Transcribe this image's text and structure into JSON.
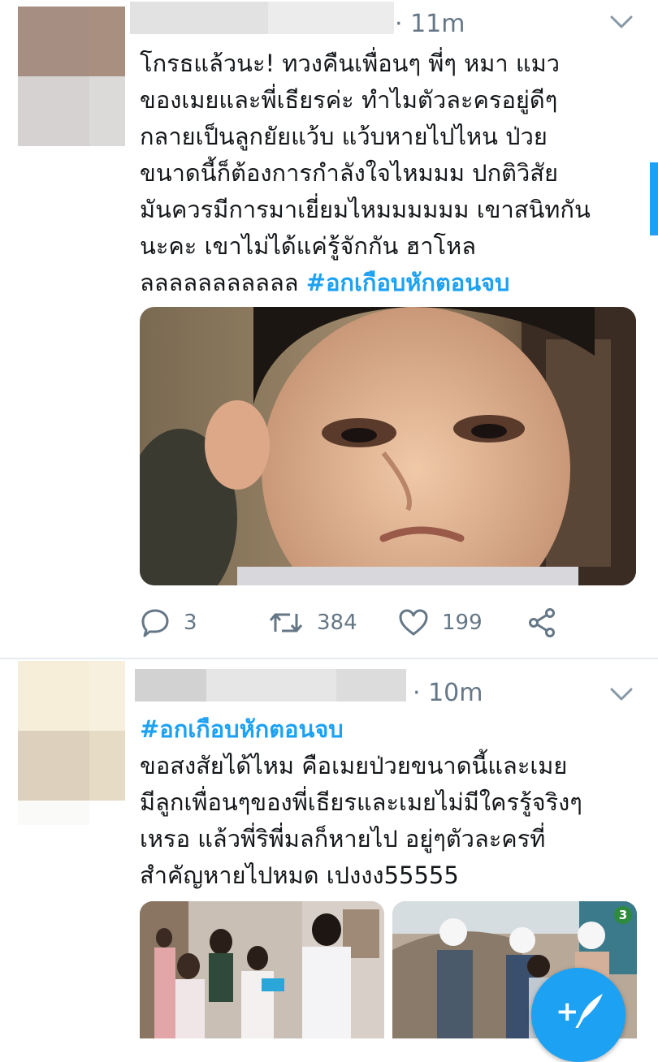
{
  "tweets": [
    {
      "time": "· 11m",
      "text": "โกรธแล้วนะ! ทวงคืนเพื่อนๆ พี่ๆ หมา แมว\nของเมยและพี่เธียรค่ะ ทำไมตัวละครอยู่ดีๆ\nกลายเป็นลูกยัยแว้บ แว้บหายไปไหน ป่วย\nขนาดนี้ก็ต้องการกำลังใจไหมมม ปกติวิสัย\nมันควรมีการมาเยี่ยมไหมมมมมม เขาสนิทกัน\nนะคะ เขาไม่ได้แค่รู้จักกัน ฮาโหล\nลลลลลลลลลลล ",
      "hashtag": "#อกเกือบหักตอนจบ",
      "media_icon": "photo-of-pouting-boy",
      "replies": "3",
      "retweets": "384",
      "likes": "199"
    },
    {
      "time": "· 10m",
      "hashtag": "#อกเกือบหักตอนจบ",
      "text": "ขอสงสัยได้ไหม คือเมยป่วยขนาดนี้และเมย\nมีลูกเพื่อนๆของพี่เธียรและเมยไม่มีใครรู้จริงๆ\nเหรอ แล้วพี่ริพี่มลก็หายไป อยู่ๆตัวละครที่\nสำคัญหายไปหมด เปงงง55555",
      "media_icons": [
        "photo-drama-scene-indoor",
        "photo-drama-scene-construction"
      ],
      "channel_badge": "3"
    }
  ],
  "fab_icon": "compose-tweet-icon",
  "colors": {
    "accent": "#1da1f2",
    "muted": "#657786",
    "text": "#14171a",
    "divider": "#e6ecf0"
  }
}
